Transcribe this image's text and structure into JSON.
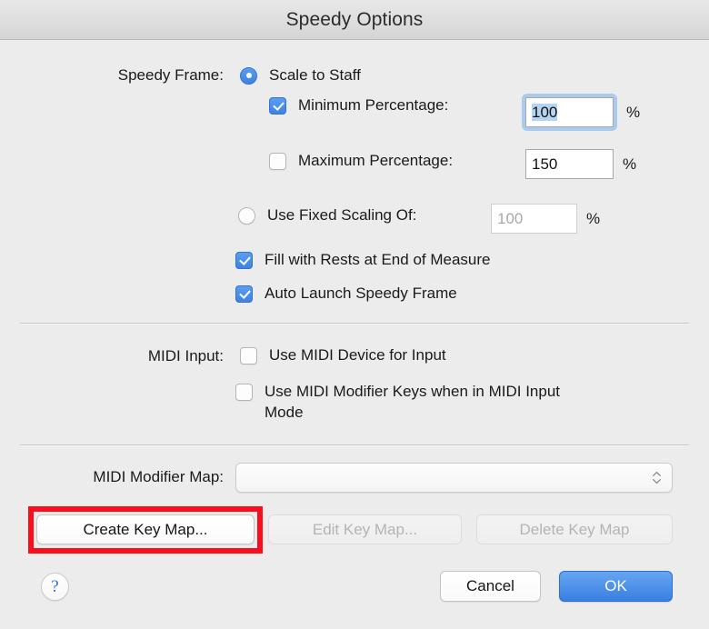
{
  "window": {
    "title": "Speedy Options"
  },
  "speedy_frame": {
    "label": "Speedy Frame:",
    "scale_to_staff": {
      "label": "Scale to Staff",
      "selected": true
    },
    "minimum_percentage": {
      "label": "Minimum Percentage:",
      "checked": true,
      "value": "100",
      "unit": "%"
    },
    "maximum_percentage": {
      "label": "Maximum Percentage:",
      "checked": false,
      "value": "150",
      "unit": "%"
    },
    "use_fixed_scaling": {
      "label": "Use Fixed Scaling Of:",
      "selected": false,
      "value": "100",
      "unit": "%"
    },
    "fill_with_rests": {
      "label": "Fill with Rests at End of Measure",
      "checked": true
    },
    "auto_launch": {
      "label": "Auto Launch Speedy Frame",
      "checked": true
    }
  },
  "midi_input": {
    "label": "MIDI Input:",
    "use_midi_device": {
      "label": "Use MIDI Device for Input",
      "checked": false
    },
    "use_midi_modifier_keys": {
      "label": "Use MIDI Modifier Keys when in MIDI Input Mode",
      "checked": false
    }
  },
  "midi_modifier_map": {
    "label": "MIDI Modifier Map:",
    "value": "",
    "icon": "chevron-up-down-icon"
  },
  "key_map_buttons": {
    "create": {
      "label": "Create Key Map...",
      "enabled": true,
      "highlighted": true
    },
    "edit": {
      "label": "Edit Key Map...",
      "enabled": false
    },
    "delete": {
      "label": "Delete Key Map",
      "enabled": false
    }
  },
  "footer": {
    "help": {
      "label": "?",
      "icon": "help-icon"
    },
    "cancel": {
      "label": "Cancel"
    },
    "ok": {
      "label": "OK",
      "default": true
    }
  },
  "colors": {
    "accent": "#3d82e4",
    "annotation": "#fc0d1b",
    "selection": "#b4d5f2",
    "focus_ring": "#a8cbee",
    "window_bg": "#ececec"
  }
}
